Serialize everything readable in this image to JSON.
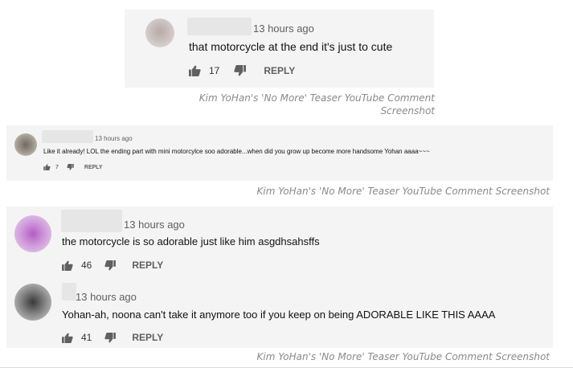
{
  "screenshot1": {
    "comment": {
      "timestamp": "13 hours ago",
      "text": "that motorcycle at the end it's just to cute",
      "likes": "17",
      "reply_label": "REPLY"
    },
    "caption_line1": "Kim YoHan's 'No More' Teaser YouTube Comment",
    "caption_line2": "Screenshot"
  },
  "screenshot2": {
    "comment": {
      "timestamp": "13 hours ago",
      "text": "Like it already! LOL the ending part with mini motorcylce soo adorable...when did you grow up become more handsome Yohan aaaa~~~",
      "likes": "7",
      "reply_label": "REPLY"
    },
    "caption": "Kim YoHan's 'No More' Teaser YouTube Comment Screenshot"
  },
  "screenshot3": {
    "comments": [
      {
        "timestamp": "13 hours ago",
        "text": "the motorcycle is so adorable just like him asgdhsahsffs",
        "likes": "46",
        "reply_label": "REPLY"
      },
      {
        "timestamp": "13 hours ago",
        "text": "Yohan-ah, noona can't take it anymore too if you keep on being ADORABLE LIKE THIS AAAA",
        "likes": "41",
        "reply_label": "REPLY"
      }
    ],
    "caption": "Kim YoHan's 'No More' Teaser YouTube Comment Screenshot"
  },
  "colors": {
    "panel_bg": "#f4f4f4",
    "text": "#111111",
    "meta": "#606060",
    "caption": "#8a8a8a"
  },
  "icons": [
    "avatar",
    "thumbs-up-icon",
    "thumbs-down-icon"
  ]
}
